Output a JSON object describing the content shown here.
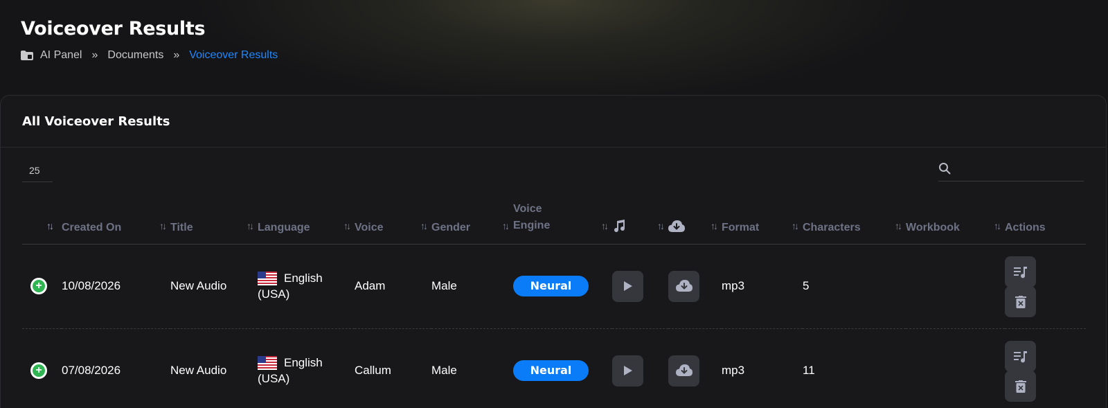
{
  "page": {
    "title": "Voiceover Results",
    "breadcrumb": [
      "AI Panel",
      "Documents",
      "Voiceover Results"
    ],
    "breadcrumb_sep": "»"
  },
  "card": {
    "title": "All Voiceover Results"
  },
  "controls": {
    "page_size": "25",
    "search_value": ""
  },
  "table": {
    "columns": [
      "",
      "Created On",
      "Title",
      "Language",
      "Voice",
      "Gender",
      "Voice Engine",
      "music-icon",
      "download-cloud-icon",
      "Format",
      "Characters",
      "Workbook",
      "Actions"
    ],
    "sort_glyph": "↑↓",
    "rows": [
      {
        "created_on": "10/08/2026",
        "title": "New Audio",
        "language_line1": "English",
        "language_line2": "(USA)",
        "voice": "Adam",
        "gender": "Male",
        "engine": "Neural",
        "format": "mp3",
        "characters": "5",
        "workbook": ""
      },
      {
        "created_on": "07/08/2026",
        "title": "New Audio",
        "language_line1": "English",
        "language_line2": "(USA)",
        "voice": "Callum",
        "gender": "Male",
        "engine": "Neural",
        "format": "mp3",
        "characters": "11",
        "workbook": ""
      }
    ]
  },
  "colors": {
    "accent": "#1e88ff",
    "badge": "#0a7cf7",
    "add": "#2fb552",
    "header_text": "#6e7285"
  }
}
